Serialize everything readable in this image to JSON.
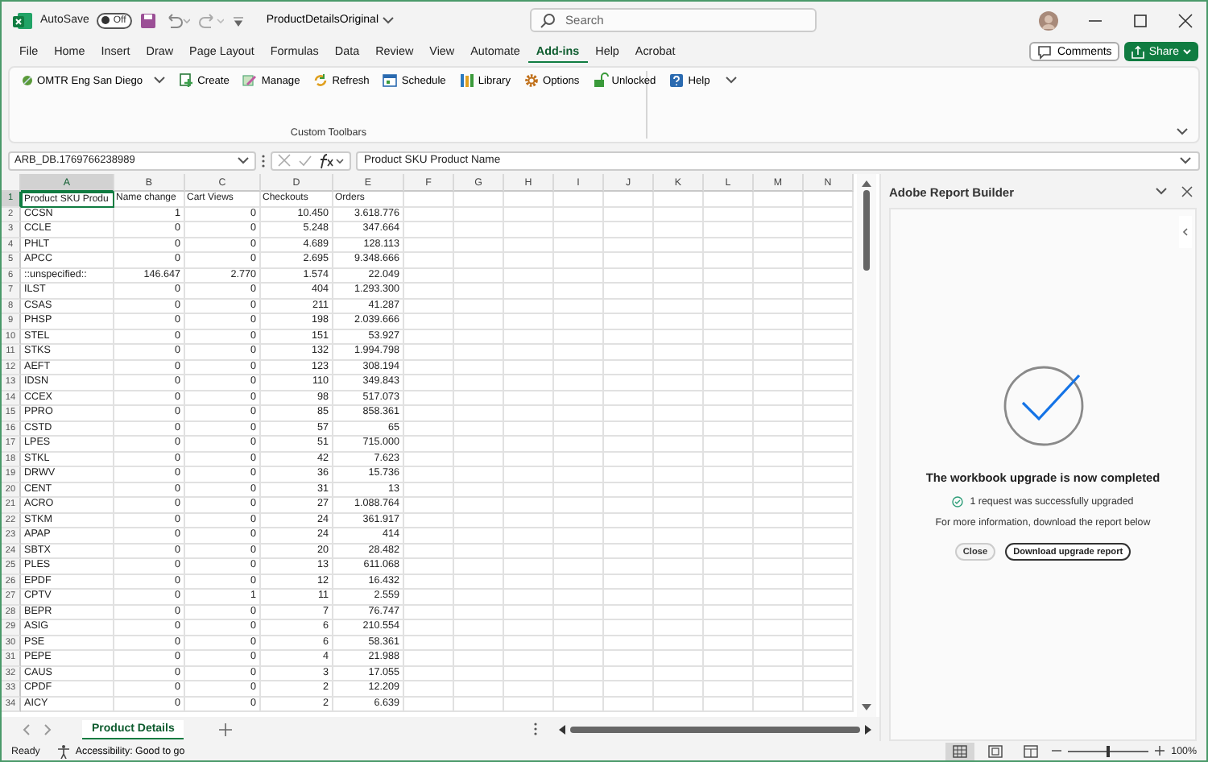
{
  "title_bar": {
    "autosave_label": "AutoSave",
    "autosave": {
      "label": "Off",
      "on": false
    },
    "file_name": "ProductDetailsOriginal",
    "search": {
      "placeholder": "Search"
    }
  },
  "menu_tabs": [
    {
      "label": "File",
      "selected": false
    },
    {
      "label": "Home",
      "selected": false
    },
    {
      "label": "Insert",
      "selected": false
    },
    {
      "label": "Draw",
      "selected": false
    },
    {
      "label": "Page Layout",
      "selected": false
    },
    {
      "label": "Formulas",
      "selected": false
    },
    {
      "label": "Data",
      "selected": false
    },
    {
      "label": "Review",
      "selected": false
    },
    {
      "label": "View",
      "selected": false
    },
    {
      "label": "Automate",
      "selected": false
    },
    {
      "label": "Add-ins",
      "selected": true
    },
    {
      "label": "Help",
      "selected": false
    },
    {
      "label": "Acrobat",
      "selected": false
    }
  ],
  "comments_button": "Comments",
  "share_button": "Share",
  "ribbon": {
    "dropdown": "OMTR Eng San Diego",
    "buttons": [
      "Create",
      "Manage",
      "Refresh",
      "Schedule",
      "Library",
      "Options",
      "Unlocked",
      "Help"
    ],
    "group_label": "Custom Toolbars"
  },
  "formula_bar": {
    "name_box": "ARB_DB.1769766238989",
    "formula": "Product SKU Product Name"
  },
  "sheet": {
    "columns": [
      {
        "label": "A",
        "selected": true
      },
      {
        "label": "B",
        "selected": false
      },
      {
        "label": "C",
        "selected": false
      },
      {
        "label": "D",
        "selected": false
      },
      {
        "label": "E",
        "selected": false
      },
      {
        "label": "F",
        "selected": false
      },
      {
        "label": "G",
        "selected": false
      },
      {
        "label": "H",
        "selected": false
      },
      {
        "label": "I",
        "selected": false
      },
      {
        "label": "J",
        "selected": false
      },
      {
        "label": "K",
        "selected": false
      },
      {
        "label": "L",
        "selected": false
      },
      {
        "label": "M",
        "selected": false
      },
      {
        "label": "N",
        "selected": false
      }
    ],
    "rows": [
      {
        "number": "1",
        "selected": true,
        "kind": "header",
        "cells": [
          "Product SKU Produ",
          "Name change",
          "Cart Views",
          "Checkouts",
          "Orders"
        ]
      },
      {
        "number": "2",
        "selected": false,
        "kind": "data",
        "cells": [
          "CCSN",
          "1",
          "0",
          "10.450",
          "3.618.776"
        ]
      },
      {
        "number": "3",
        "selected": false,
        "kind": "data",
        "cells": [
          "CCLE",
          "0",
          "0",
          "5.248",
          "347.664"
        ]
      },
      {
        "number": "4",
        "selected": false,
        "kind": "data",
        "cells": [
          "PHLT",
          "0",
          "0",
          "4.689",
          "128.113"
        ]
      },
      {
        "number": "5",
        "selected": false,
        "kind": "data",
        "cells": [
          "APCC",
          "0",
          "0",
          "2.695",
          "9.348.666"
        ]
      },
      {
        "number": "6",
        "selected": false,
        "kind": "data",
        "cells": [
          "::unspecified::",
          "146.647",
          "2.770",
          "1.574",
          "22.049"
        ]
      },
      {
        "number": "7",
        "selected": false,
        "kind": "data",
        "cells": [
          "ILST",
          "0",
          "0",
          "404",
          "1.293.300"
        ]
      },
      {
        "number": "8",
        "selected": false,
        "kind": "data",
        "cells": [
          "CSAS",
          "0",
          "0",
          "211",
          "41.287"
        ]
      },
      {
        "number": "9",
        "selected": false,
        "kind": "data",
        "cells": [
          "PHSP",
          "0",
          "0",
          "198",
          "2.039.666"
        ]
      },
      {
        "number": "10",
        "selected": false,
        "kind": "data",
        "cells": [
          "STEL",
          "0",
          "0",
          "151",
          "53.927"
        ]
      },
      {
        "number": "11",
        "selected": false,
        "kind": "data",
        "cells": [
          "STKS",
          "0",
          "0",
          "132",
          "1.994.798"
        ]
      },
      {
        "number": "12",
        "selected": false,
        "kind": "data",
        "cells": [
          "AEFT",
          "0",
          "0",
          "123",
          "308.194"
        ]
      },
      {
        "number": "13",
        "selected": false,
        "kind": "data",
        "cells": [
          "IDSN",
          "0",
          "0",
          "110",
          "349.843"
        ]
      },
      {
        "number": "14",
        "selected": false,
        "kind": "data",
        "cells": [
          "CCEX",
          "0",
          "0",
          "98",
          "517.073"
        ]
      },
      {
        "number": "15",
        "selected": false,
        "kind": "data",
        "cells": [
          "PPRO",
          "0",
          "0",
          "85",
          "858.361"
        ]
      },
      {
        "number": "16",
        "selected": false,
        "kind": "data",
        "cells": [
          "CSTD",
          "0",
          "0",
          "57",
          "65"
        ]
      },
      {
        "number": "17",
        "selected": false,
        "kind": "data",
        "cells": [
          "LPES",
          "0",
          "0",
          "51",
          "715.000"
        ]
      },
      {
        "number": "18",
        "selected": false,
        "kind": "data",
        "cells": [
          "STKL",
          "0",
          "0",
          "42",
          "7.623"
        ]
      },
      {
        "number": "19",
        "selected": false,
        "kind": "data",
        "cells": [
          "DRWV",
          "0",
          "0",
          "36",
          "15.736"
        ]
      },
      {
        "number": "20",
        "selected": false,
        "kind": "data",
        "cells": [
          "CENT",
          "0",
          "0",
          "31",
          "13"
        ]
      },
      {
        "number": "21",
        "selected": false,
        "kind": "data",
        "cells": [
          "ACRO",
          "0",
          "0",
          "27",
          "1.088.764"
        ]
      },
      {
        "number": "22",
        "selected": false,
        "kind": "data",
        "cells": [
          "STKM",
          "0",
          "0",
          "24",
          "361.917"
        ]
      },
      {
        "number": "23",
        "selected": false,
        "kind": "data",
        "cells": [
          "APAP",
          "0",
          "0",
          "24",
          "414"
        ]
      },
      {
        "number": "24",
        "selected": false,
        "kind": "data",
        "cells": [
          "SBTX",
          "0",
          "0",
          "20",
          "28.482"
        ]
      },
      {
        "number": "25",
        "selected": false,
        "kind": "data",
        "cells": [
          "PLES",
          "0",
          "0",
          "13",
          "611.068"
        ]
      },
      {
        "number": "26",
        "selected": false,
        "kind": "data",
        "cells": [
          "EPDF",
          "0",
          "0",
          "12",
          "16.432"
        ]
      },
      {
        "number": "27",
        "selected": false,
        "kind": "data",
        "cells": [
          "CPTV",
          "0",
          "1",
          "11",
          "2.559"
        ]
      },
      {
        "number": "28",
        "selected": false,
        "kind": "data",
        "cells": [
          "BEPR",
          "0",
          "0",
          "7",
          "76.747"
        ]
      },
      {
        "number": "29",
        "selected": false,
        "kind": "data",
        "cells": [
          "ASIG",
          "0",
          "0",
          "6",
          "210.554"
        ]
      },
      {
        "number": "30",
        "selected": false,
        "kind": "data",
        "cells": [
          "PSE",
          "0",
          "0",
          "6",
          "58.361"
        ]
      },
      {
        "number": "31",
        "selected": false,
        "kind": "data",
        "cells": [
          "PEPE",
          "0",
          "0",
          "4",
          "21.988"
        ]
      },
      {
        "number": "32",
        "selected": false,
        "kind": "data",
        "cells": [
          "CAUS",
          "0",
          "0",
          "3",
          "17.055"
        ]
      },
      {
        "number": "33",
        "selected": false,
        "kind": "data",
        "cells": [
          "CPDF",
          "0",
          "0",
          "2",
          "12.209"
        ]
      },
      {
        "number": "34",
        "selected": false,
        "kind": "data",
        "cells": [
          "AICY",
          "0",
          "0",
          "2",
          "6.639"
        ]
      }
    ]
  },
  "sheet_tabs": [
    {
      "label": "Product Details",
      "selected": true
    }
  ],
  "task_pane": {
    "title": "Adobe Report Builder",
    "heading": "The workbook upgrade is now completed",
    "status": "1 request was successfully upgraded",
    "note": "For more information, download the report below",
    "buttons": [
      "Close",
      "Download upgrade report"
    ]
  },
  "status_bar": {
    "status": "Ready",
    "accessibility": "Accessibility: Good to go",
    "views": [
      {
        "selected": true
      },
      {
        "selected": false
      },
      {
        "selected": false
      }
    ],
    "zoom": {
      "level": 0.5,
      "reading": "100%"
    }
  }
}
